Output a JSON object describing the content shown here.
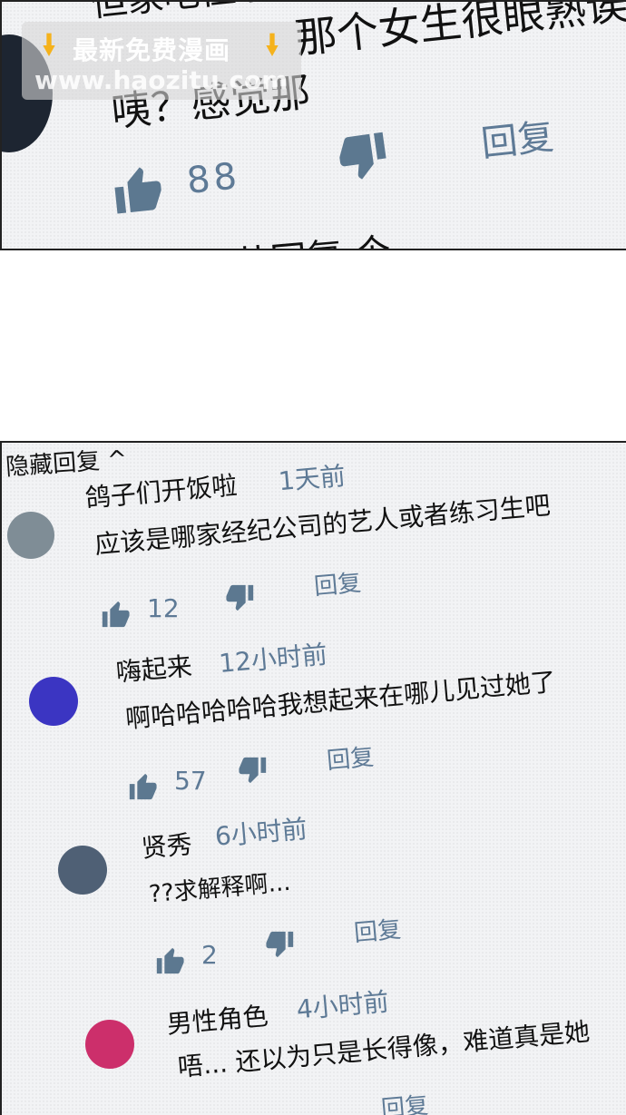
{
  "top_panel": {
    "line_top_partial": "但家吧但系",
    "line_main": "那个女生很眼熟诶",
    "line_second": "咦？感觉那",
    "likes": "88",
    "reply": "回复",
    "bottom_partial": "共回复 个"
  },
  "watermark": {
    "line1": "最新免费漫画",
    "line2": "www.haozitu.com"
  },
  "bottom_panel": {
    "header_partial": "隐藏回复 ^",
    "comments": [
      {
        "user": "鸽子们开饭啦",
        "time": "1天前",
        "text": "应该是哪家经纪公司的艺人或者练习生吧",
        "likes": "12",
        "reply": "回复",
        "avatar_color": "#7f8d96"
      },
      {
        "user": "嗨起来",
        "time": "12小时前",
        "text": "啊哈哈哈哈哈我想起来在哪儿见过她了",
        "likes": "57",
        "reply": "回复",
        "avatar_color": "#3b35c2"
      },
      {
        "user": "贤秀",
        "time": "6小时前",
        "text": "??求解释啊...",
        "likes": "2",
        "reply": "回复",
        "avatar_color": "#4f6075"
      },
      {
        "user": "男性角色",
        "time": "4小时前",
        "text": "唔... 还以为只是长得像，难道真是她",
        "likes": "",
        "reply": "回复",
        "avatar_color": "#cc2f6b"
      }
    ]
  },
  "colors": {
    "meta": "#5e7a96",
    "icon": "#5c7890",
    "border": "#222222",
    "paper": "#f2f3f5"
  }
}
